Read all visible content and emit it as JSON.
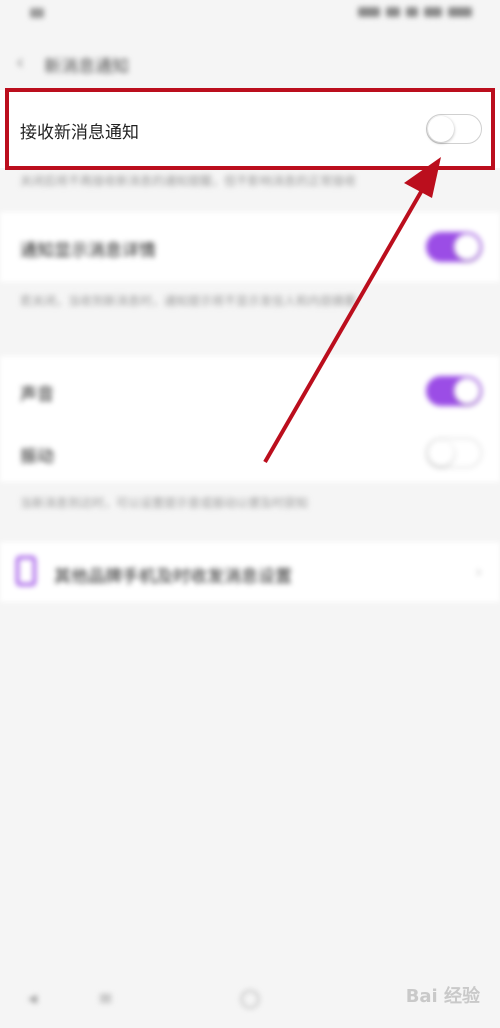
{
  "header": {
    "title": "新消息通知",
    "back_icon": "chevron-left-icon"
  },
  "settings": {
    "receive_new_messages": {
      "label": "接收新消息通知",
      "enabled": false,
      "hint": "关闭后将不再接收新消息的通知提醒，但不影响消息的正常接收"
    },
    "show_details": {
      "label": "通知显示消息详情",
      "enabled": true,
      "hint": "若关闭，当收到新消息时，通知提示将不显示发信人和内容摘要"
    },
    "sound": {
      "label": "声音",
      "enabled": true
    },
    "vibrate": {
      "label": "振动",
      "enabled": false,
      "hint": "当新消息到达时，可以设置提示音或振动以便及时获知"
    },
    "other_brand": {
      "label": "其他品牌手机及时收发消息设置",
      "icon": "phone-icon"
    }
  },
  "watermark": "Bai 经验",
  "colors": {
    "accent": "#9b4de6",
    "highlight": "#bb0e1d"
  }
}
